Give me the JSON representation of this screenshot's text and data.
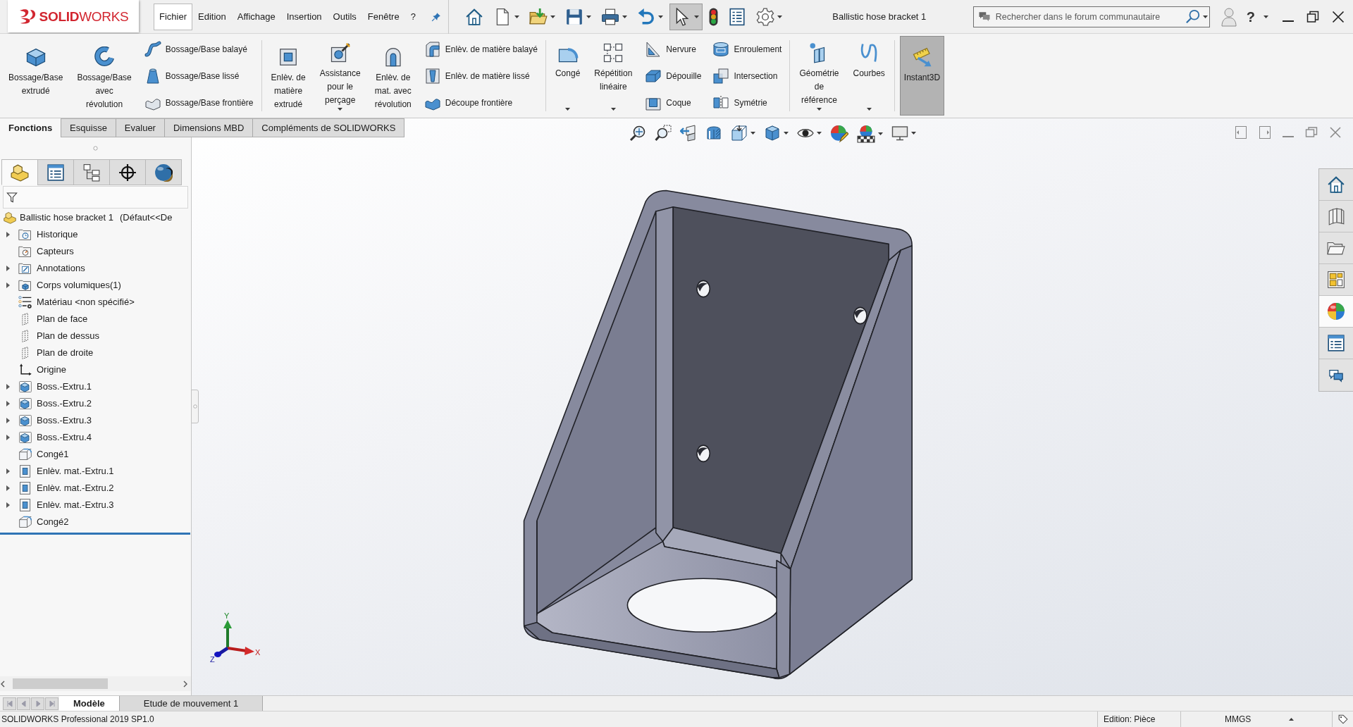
{
  "logo": {
    "text": "**SOLID**WORKS"
  },
  "menu": [
    {
      "label": "Fichier",
      "selected": true
    },
    {
      "label": "Edition",
      "selected": false
    },
    {
      "label": "Affichage",
      "selected": false
    },
    {
      "label": "Insertion",
      "selected": false
    },
    {
      "label": "Outils",
      "selected": false
    },
    {
      "label": "Fenêtre",
      "selected": false
    },
    {
      "label": "?",
      "selected": false
    }
  ],
  "quick_access": [
    {
      "kind": "home",
      "dropdown": false,
      "selected": false
    },
    {
      "kind": "new",
      "dropdown": true,
      "selected": false
    },
    {
      "kind": "open",
      "dropdown": true,
      "selected": false
    },
    {
      "kind": "save",
      "dropdown": true,
      "selected": false
    },
    {
      "kind": "print",
      "dropdown": true,
      "selected": false
    },
    {
      "kind": "undo",
      "dropdown": true,
      "selected": false
    },
    {
      "kind": "select",
      "dropdown": true,
      "selected": true
    },
    {
      "kind": "rebuild",
      "dropdown": false,
      "selected": false
    },
    {
      "kind": "properties",
      "dropdown": false,
      "selected": false
    },
    {
      "kind": "options",
      "dropdown": true,
      "selected": false
    }
  ],
  "document_title": "Ballistic hose bracket 1",
  "search": {
    "placeholder": "Rechercher dans le forum communautaire"
  },
  "help": {
    "label": "?"
  },
  "ribbon": {
    "groups": [
      {
        "items": [
          {
            "kind": "extrude",
            "lines": [
              "Bossage/Base",
              "extrudé"
            ],
            "dropdown": false,
            "selected": false
          },
          {
            "kind": "revolve",
            "lines": [
              "Bossage/Base",
              "avec",
              "révolution"
            ],
            "dropdown": false,
            "selected": false
          },
          {
            "kind": "stack",
            "items": [
              {
                "kind": "sweep",
                "label": "Bossage/Base balayé",
                "selected": false
              },
              {
                "kind": "loft",
                "label": "Bossage/Base lissé",
                "selected": false
              },
              {
                "kind": "boundary",
                "label": "Bossage/Base frontière",
                "selected": false
              }
            ]
          }
        ]
      },
      {
        "items": [
          {
            "kind": "extrude-cut",
            "lines": [
              "Enlèv. de",
              "matière",
              "extrudé"
            ],
            "dropdown": false,
            "selected": false
          },
          {
            "kind": "hole-wizard",
            "lines": [
              "Assistance",
              "pour le",
              "perçage"
            ],
            "dropdown": true,
            "selected": false
          },
          {
            "kind": "revolve-cut",
            "lines": [
              "Enlèv. de",
              "mat. avec",
              "révolution"
            ],
            "dropdown": false,
            "selected": false
          },
          {
            "kind": "stack",
            "items": [
              {
                "kind": "sweep-cut",
                "label": "Enlèv. de matière balayé",
                "selected": false
              },
              {
                "kind": "loft-cut",
                "label": "Enlèv. de matière lissé",
                "selected": false
              },
              {
                "kind": "boundary-cut",
                "label": "Découpe frontière",
                "selected": false
              }
            ]
          }
        ]
      },
      {
        "items": [
          {
            "kind": "fillet",
            "lines": [
              "Congé"
            ],
            "dropdown": true,
            "selected": false
          },
          {
            "kind": "linear-pattern",
            "lines": [
              "Répétition",
              "linéaire"
            ],
            "dropdown": true,
            "selected": false
          },
          {
            "kind": "stack",
            "items": [
              {
                "kind": "rib",
                "label": "Nervure",
                "selected": false
              },
              {
                "kind": "draft",
                "label": "Dépouille",
                "selected": false
              },
              {
                "kind": "shell",
                "label": "Coque",
                "selected": false
              }
            ]
          },
          {
            "kind": "stack",
            "items": [
              {
                "kind": "wrap",
                "label": "Enroulement",
                "selected": false
              },
              {
                "kind": "intersect",
                "label": "Intersection",
                "selected": false
              },
              {
                "kind": "mirror",
                "label": "Symétrie",
                "selected": false
              }
            ]
          }
        ]
      },
      {
        "items": [
          {
            "kind": "reference-geometry",
            "lines": [
              "Géométrie",
              "de",
              "référence"
            ],
            "dropdown": true,
            "selected": false
          },
          {
            "kind": "curves",
            "lines": [
              "Courbes"
            ],
            "dropdown": true,
            "selected": false
          }
        ]
      },
      {
        "items": [
          {
            "kind": "instant3d",
            "lines": [
              "Instant3D"
            ],
            "dropdown": false,
            "selected": true
          }
        ]
      }
    ]
  },
  "command_tabs": [
    {
      "label": "Fonctions",
      "selected": true
    },
    {
      "label": "Esquisse",
      "selected": false
    },
    {
      "label": "Evaluer",
      "selected": false
    },
    {
      "label": "Dimensions MBD",
      "selected": false
    },
    {
      "label": "Compléments de SOLIDWORKS",
      "selected": false
    }
  ],
  "manager_tabs": [
    {
      "kind": "features",
      "selected": true
    },
    {
      "kind": "properties",
      "selected": false
    },
    {
      "kind": "configurations",
      "selected": false
    },
    {
      "kind": "dimxpert",
      "selected": false
    },
    {
      "kind": "display",
      "selected": false
    }
  ],
  "feature_tree": {
    "name": "Ballistic hose bracket 1",
    "configuration": "(Défaut<<De",
    "children": [
      {
        "label": "Historique",
        "kind": "history",
        "expandable": true
      },
      {
        "label": "Capteurs",
        "kind": "sensors",
        "expandable": false
      },
      {
        "label": "Annotations",
        "kind": "annotations",
        "expandable": true
      },
      {
        "label": "Corps volumiques(1)",
        "kind": "bodies",
        "expandable": true
      },
      {
        "label": "Matériau <non spécifié>",
        "kind": "material",
        "expandable": false
      },
      {
        "label": "Plan de face",
        "kind": "plane",
        "expandable": false
      },
      {
        "label": "Plan de dessus",
        "kind": "plane",
        "expandable": false
      },
      {
        "label": "Plan de droite",
        "kind": "plane",
        "expandable": false
      },
      {
        "label": "Origine",
        "kind": "origin",
        "expandable": false
      },
      {
        "label": "Boss.-Extru.1",
        "kind": "boss",
        "expandable": true
      },
      {
        "label": "Boss.-Extru.2",
        "kind": "boss",
        "expandable": true
      },
      {
        "label": "Boss.-Extru.3",
        "kind": "boss",
        "expandable": true
      },
      {
        "label": "Boss.-Extru.4",
        "kind": "boss",
        "expandable": true
      },
      {
        "label": "Congé1",
        "kind": "fillet",
        "expandable": false
      },
      {
        "label": "Enlèv. mat.-Extru.1",
        "kind": "cut",
        "expandable": true
      },
      {
        "label": "Enlèv. mat.-Extru.2",
        "kind": "cut",
        "expandable": true
      },
      {
        "label": "Enlèv. mat.-Extru.3",
        "kind": "cut",
        "expandable": true
      },
      {
        "label": "Congé2",
        "kind": "fillet",
        "expandable": false
      }
    ]
  },
  "task_pane": [
    {
      "kind": "resources",
      "selected": false
    },
    {
      "kind": "design-library",
      "selected": false
    },
    {
      "kind": "file-explorer",
      "selected": false
    },
    {
      "kind": "view-palette",
      "selected": false
    },
    {
      "kind": "appearances",
      "selected": true
    },
    {
      "kind": "custom-properties",
      "selected": false
    },
    {
      "kind": "forum",
      "selected": false
    }
  ],
  "triad": {
    "x": "X",
    "y": "Y",
    "z": "Z"
  },
  "bottom_tabs": [
    {
      "label": "Modèle",
      "selected": true
    },
    {
      "label": "Etude de mouvement 1",
      "selected": false
    }
  ],
  "status_bar": {
    "product": "SOLIDWORKS Professional 2019 SP1.0",
    "mode": "Edition: Pièce",
    "units": "MMGS"
  }
}
